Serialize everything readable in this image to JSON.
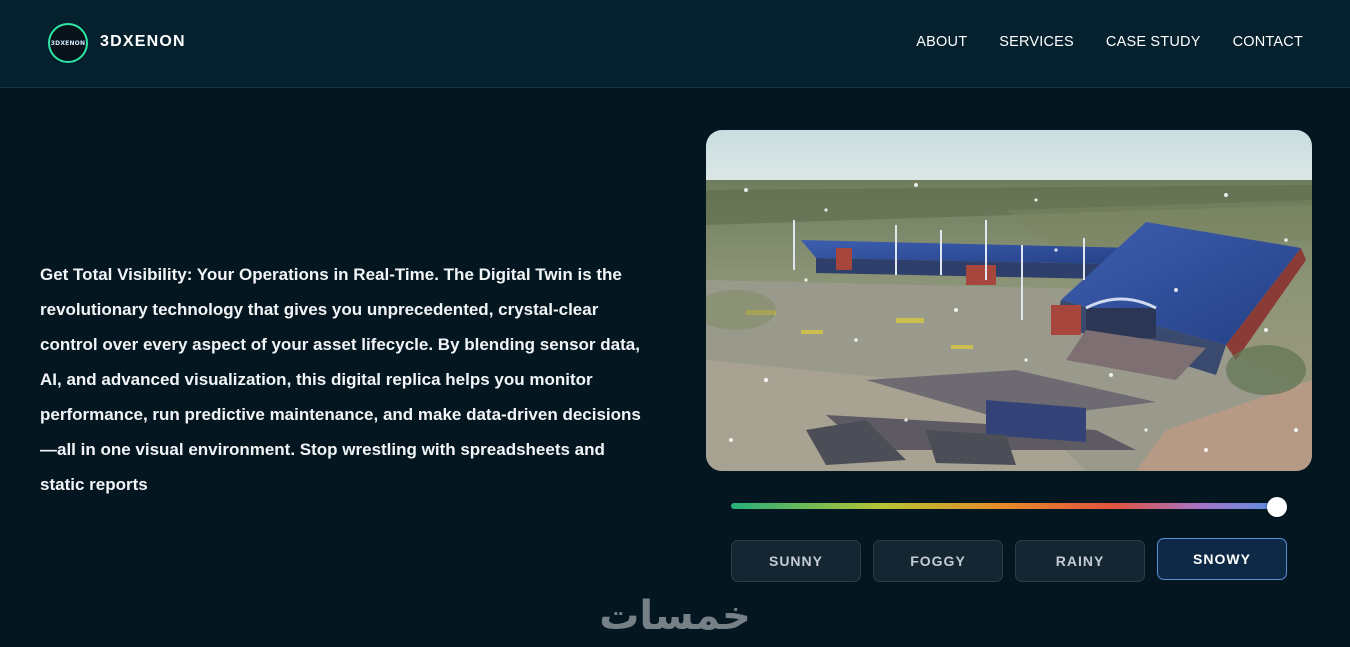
{
  "brand": {
    "name": "3DXENON",
    "logo_text": "3DXENON"
  },
  "nav": {
    "items": [
      "ABOUT",
      "SERVICES",
      "CASE STUDY",
      "CONTACT"
    ]
  },
  "hero": {
    "description": "Get Total Visibility: Your Operations in Real-Time. The Digital Twin is the revolutionary technology that gives you unprecedented, crystal-clear control over every aspect of your asset lifecycle. By blending sensor data, AI, and advanced visualization, this digital replica helps you monitor performance, run predictive maintenance, and make data-driven decisions—all in one visual environment. Stop wrestling with spreadsheets and static reports"
  },
  "weather": {
    "slider_value": 1.0,
    "buttons": [
      "SUNNY",
      "FOGGY",
      "RAINY",
      "SNOWY"
    ],
    "selected": "SNOWY"
  },
  "watermark": "خمسات",
  "colors": {
    "background": "#041620",
    "header": "#05212e",
    "accent": "#2ee6a6",
    "active_button_border": "#5d8fd6"
  }
}
